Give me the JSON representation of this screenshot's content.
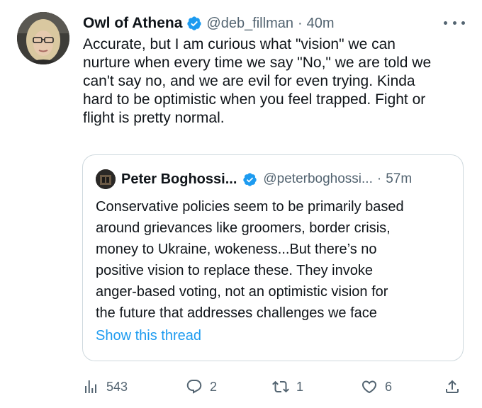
{
  "tweet": {
    "author": {
      "display_name": "Owl of Athena",
      "handle": "@deb_fillman",
      "time": "40m",
      "verified_icon": "verified-badge-icon",
      "avatar": "avatar-photo"
    },
    "separator": "·",
    "more_icon": "more-options-icon",
    "text": "Accurate, but I am curious what \"vision\" we can\nnurture when every time we say \"No,\" we are told we\ncan't say no, and we are evil for even trying. Kinda\nhard to be optimistic when you feel trapped. Fight or\nflight is pretty normal.",
    "quoted": {
      "display_name": "Peter Boghossi...",
      "handle": "@peterboghossi...",
      "time": "57m",
      "verified_icon": "verified-badge-icon",
      "text": "Conservative policies seem to be primarily based\naround grievances like groomers, border crisis,\nmoney to Ukraine, wokeness...But there’s no\npositive vision to replace these. They invoke\nanger-based voting, not an optimistic vision for\nthe future that addresses challenges we face",
      "link_label": "Show this thread"
    },
    "actions": {
      "views": "543",
      "replies": "2",
      "retweets": "1",
      "likes": "6"
    }
  },
  "colors": {
    "text": "#0f1419",
    "secondary": "#536471",
    "link": "#1d9bf0",
    "verified": "#1d9bf0",
    "border": "#cfd9de"
  }
}
